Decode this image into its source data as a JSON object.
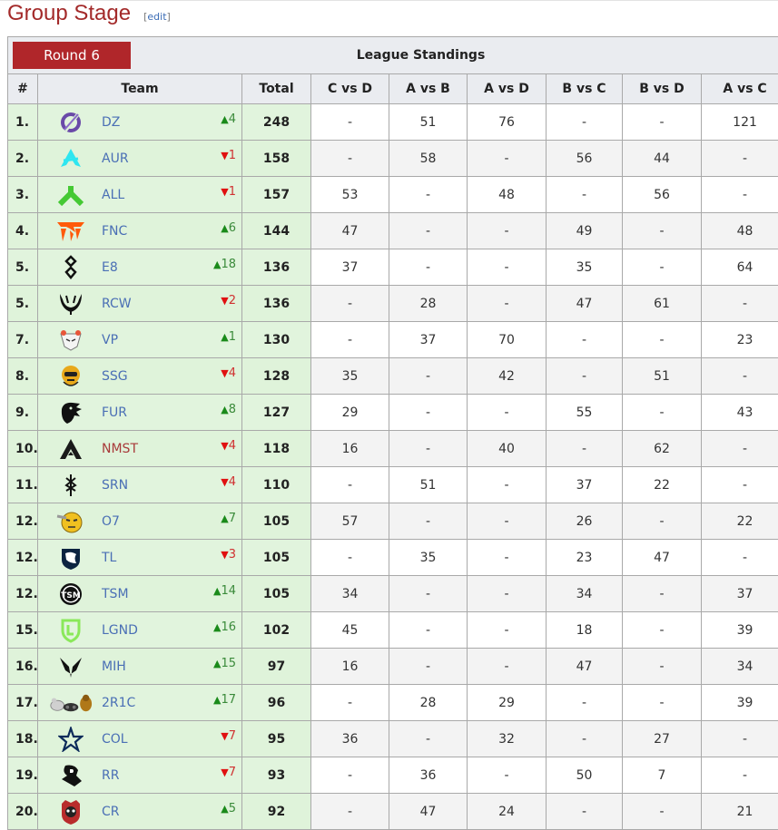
{
  "heading": {
    "title": "Group Stage",
    "edit_open": "[",
    "edit_label": "edit",
    "edit_close": "]"
  },
  "table": {
    "round_button": "Round 6",
    "caption": "League Standings",
    "columns": [
      "#",
      "Team",
      "Total",
      "C vs D",
      "A vs B",
      "A vs D",
      "B vs C",
      "B vs D",
      "A vs C"
    ],
    "rows": [
      {
        "rank": "1.",
        "logo": "dz-logo-icon",
        "team": "DZ",
        "change_dir": "up",
        "change": "4",
        "total": "248",
        "c_vs_d": "-",
        "a_vs_b": "51",
        "a_vs_d": "76",
        "b_vs_c": "-",
        "b_vs_d": "-",
        "a_vs_c": "121"
      },
      {
        "rank": "2.",
        "logo": "aur-logo-icon",
        "team": "AUR",
        "change_dir": "down",
        "change": "1",
        "total": "158",
        "c_vs_d": "-",
        "a_vs_b": "58",
        "a_vs_d": "-",
        "b_vs_c": "56",
        "b_vs_d": "44",
        "a_vs_c": "-"
      },
      {
        "rank": "3.",
        "logo": "all-logo-icon",
        "team": "ALL",
        "change_dir": "down",
        "change": "1",
        "total": "157",
        "c_vs_d": "53",
        "a_vs_b": "-",
        "a_vs_d": "48",
        "b_vs_c": "-",
        "b_vs_d": "56",
        "a_vs_c": "-"
      },
      {
        "rank": "4.",
        "logo": "fnc-logo-icon",
        "team": "FNC",
        "change_dir": "up",
        "change": "6",
        "total": "144",
        "c_vs_d": "47",
        "a_vs_b": "-",
        "a_vs_d": "-",
        "b_vs_c": "49",
        "b_vs_d": "-",
        "a_vs_c": "48"
      },
      {
        "rank": "5.",
        "logo": "e8-logo-icon",
        "team": "E8",
        "change_dir": "up",
        "change": "18",
        "total": "136",
        "c_vs_d": "37",
        "a_vs_b": "-",
        "a_vs_d": "-",
        "b_vs_c": "35",
        "b_vs_d": "-",
        "a_vs_c": "64"
      },
      {
        "rank": "5.",
        "logo": "rcw-logo-icon",
        "team": "RCW",
        "change_dir": "down",
        "change": "2",
        "total": "136",
        "c_vs_d": "-",
        "a_vs_b": "28",
        "a_vs_d": "-",
        "b_vs_c": "47",
        "b_vs_d": "61",
        "a_vs_c": "-"
      },
      {
        "rank": "7.",
        "logo": "vp-logo-icon",
        "team": "VP",
        "change_dir": "up",
        "change": "1",
        "total": "130",
        "c_vs_d": "-",
        "a_vs_b": "37",
        "a_vs_d": "70",
        "b_vs_c": "-",
        "b_vs_d": "-",
        "a_vs_c": "23"
      },
      {
        "rank": "8.",
        "logo": "ssg-logo-icon",
        "team": "SSG",
        "change_dir": "down",
        "change": "4",
        "total": "128",
        "c_vs_d": "35",
        "a_vs_b": "-",
        "a_vs_d": "42",
        "b_vs_c": "-",
        "b_vs_d": "51",
        "a_vs_c": "-"
      },
      {
        "rank": "9.",
        "logo": "fur-logo-icon",
        "team": "FUR",
        "change_dir": "up",
        "change": "8",
        "total": "127",
        "c_vs_d": "29",
        "a_vs_b": "-",
        "a_vs_d": "-",
        "b_vs_c": "55",
        "b_vs_d": "-",
        "a_vs_c": "43"
      },
      {
        "rank": "10.",
        "logo": "nmst-logo-icon",
        "team": "NMST",
        "change_dir": "down",
        "change": "4",
        "total": "118",
        "c_vs_d": "16",
        "a_vs_b": "-",
        "a_vs_d": "40",
        "b_vs_c": "-",
        "b_vs_d": "62",
        "a_vs_c": "-",
        "red_link": true
      },
      {
        "rank": "11.",
        "logo": "srn-logo-icon",
        "team": "SRN",
        "change_dir": "down",
        "change": "4",
        "total": "110",
        "c_vs_d": "-",
        "a_vs_b": "51",
        "a_vs_d": "-",
        "b_vs_c": "37",
        "b_vs_d": "22",
        "a_vs_c": "-"
      },
      {
        "rank": "12.",
        "logo": "o7-logo-icon",
        "team": "O7",
        "change_dir": "up",
        "change": "7",
        "total": "105",
        "c_vs_d": "57",
        "a_vs_b": "-",
        "a_vs_d": "-",
        "b_vs_c": "26",
        "b_vs_d": "-",
        "a_vs_c": "22"
      },
      {
        "rank": "12.",
        "logo": "tl-logo-icon",
        "team": "TL",
        "change_dir": "down",
        "change": "3",
        "total": "105",
        "c_vs_d": "-",
        "a_vs_b": "35",
        "a_vs_d": "-",
        "b_vs_c": "23",
        "b_vs_d": "47",
        "a_vs_c": "-"
      },
      {
        "rank": "12.",
        "logo": "tsm-logo-icon",
        "team": "TSM",
        "change_dir": "up",
        "change": "14",
        "total": "105",
        "c_vs_d": "34",
        "a_vs_b": "-",
        "a_vs_d": "-",
        "b_vs_c": "34",
        "b_vs_d": "-",
        "a_vs_c": "37"
      },
      {
        "rank": "15.",
        "logo": "lgnd-logo-icon",
        "team": "LGND",
        "change_dir": "up",
        "change": "16",
        "total": "102",
        "c_vs_d": "45",
        "a_vs_b": "-",
        "a_vs_d": "-",
        "b_vs_c": "18",
        "b_vs_d": "-",
        "a_vs_c": "39"
      },
      {
        "rank": "16.",
        "logo": "mih-logo-icon",
        "team": "MIH",
        "change_dir": "up",
        "change": "15",
        "total": "97",
        "c_vs_d": "16",
        "a_vs_b": "-",
        "a_vs_d": "-",
        "b_vs_c": "47",
        "b_vs_d": "-",
        "a_vs_c": "34"
      },
      {
        "rank": "17.",
        "logo": "2r1c-logo-icon",
        "team": "2R1C",
        "change_dir": "up",
        "change": "17",
        "total": "96",
        "c_vs_d": "-",
        "a_vs_b": "28",
        "a_vs_d": "29",
        "b_vs_c": "-",
        "b_vs_d": "-",
        "a_vs_c": "39"
      },
      {
        "rank": "18.",
        "logo": "col-logo-icon",
        "team": "COL",
        "change_dir": "down",
        "change": "7",
        "total": "95",
        "c_vs_d": "36",
        "a_vs_b": "-",
        "a_vs_d": "32",
        "b_vs_c": "-",
        "b_vs_d": "27",
        "a_vs_c": "-"
      },
      {
        "rank": "19.",
        "logo": "rr-logo-icon",
        "team": "RR",
        "change_dir": "down",
        "change": "7",
        "total": "93",
        "c_vs_d": "-",
        "a_vs_b": "36",
        "a_vs_d": "-",
        "b_vs_c": "50",
        "b_vs_d": "7",
        "a_vs_c": "-"
      },
      {
        "rank": "20.",
        "logo": "cr-logo-icon",
        "team": "CR",
        "change_dir": "up",
        "change": "5",
        "total": "92",
        "c_vs_d": "-",
        "a_vs_b": "47",
        "a_vs_d": "24",
        "b_vs_c": "-",
        "b_vs_d": "-",
        "a_vs_c": "21"
      }
    ]
  },
  "colors": {
    "heading": "#a32a2a",
    "round_button": "#b0262a",
    "link": "#4a6fb5",
    "red_link": "#a83a3a",
    "up": "#1a8a1a",
    "down": "#e01010",
    "highlight_row": "#dff3da"
  }
}
